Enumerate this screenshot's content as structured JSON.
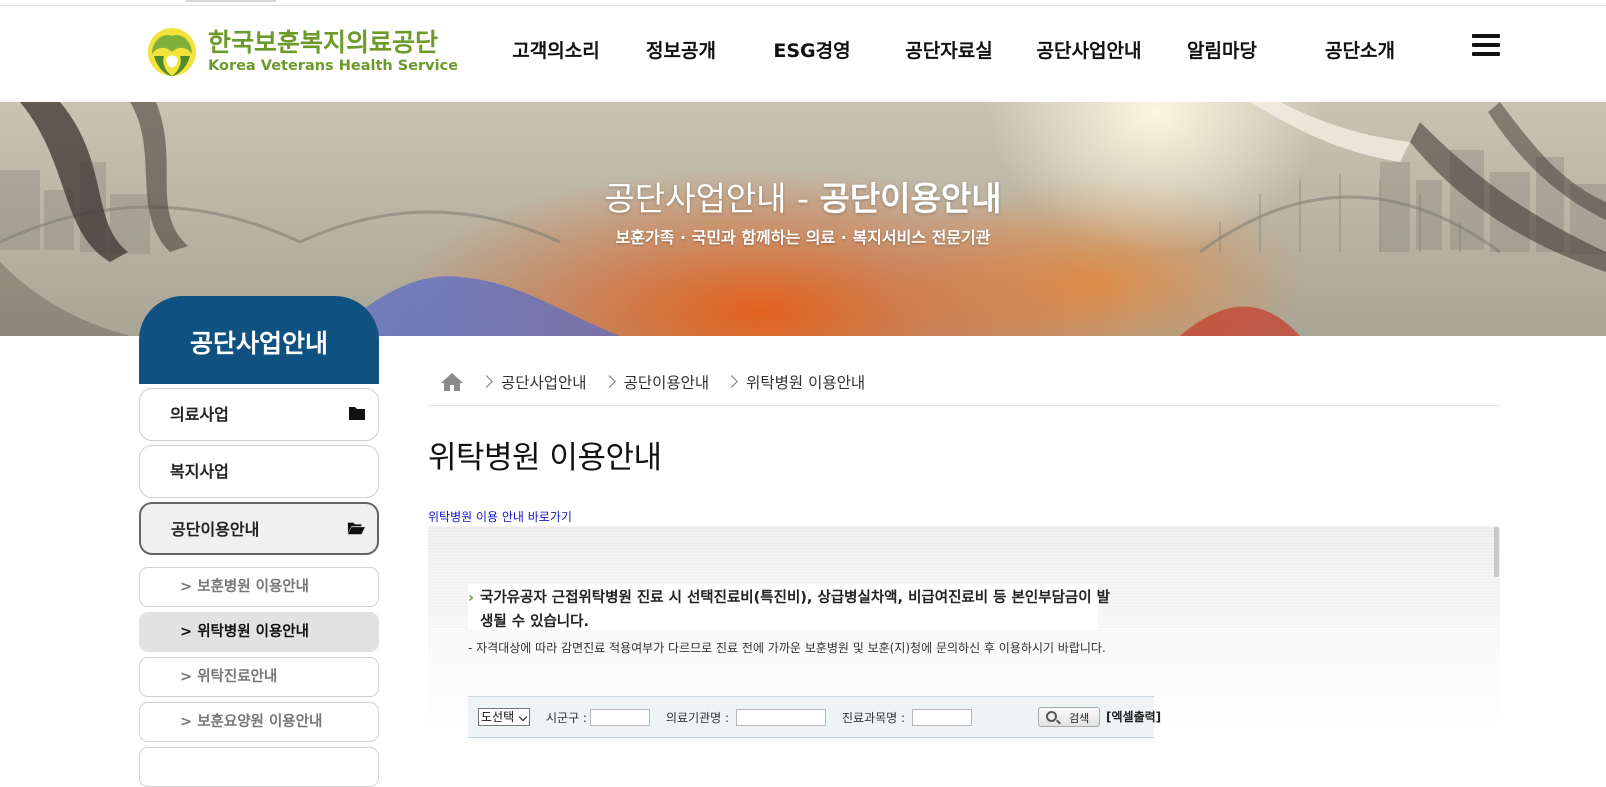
{
  "header": {
    "logo_ko": "한국보훈복지의료공단",
    "logo_en": "Korea Veterans Health Service",
    "nav": [
      {
        "label": "고객의소리"
      },
      {
        "label": "정보공개"
      },
      {
        "label": "ESG경영"
      },
      {
        "label": "공단자료실"
      },
      {
        "label": "공단사업안내"
      },
      {
        "label": "알림마당"
      },
      {
        "label": "공단소개"
      }
    ],
    "menu_icon": "hamburger-icon"
  },
  "banner": {
    "title_part1": "공단사업안내",
    "title_sep": " - ",
    "title_part2": "공단이용안내",
    "subtitle": "보훈가족 · 국민과 함께하는 의료 · 복지서비스 전문기관"
  },
  "sidebar": {
    "heading": "공단사업안내",
    "items": [
      {
        "label": "의료사업",
        "icon": "folder-icon"
      },
      {
        "label": "복지사업"
      },
      {
        "label": "공단이용안내",
        "icon": "folder-open-icon",
        "active": true
      }
    ],
    "sub_items": [
      {
        "label": "> 보훈병원 이용안내"
      },
      {
        "label": "> 위탁병원 이용안내",
        "active": true
      },
      {
        "label": "> 위탁진료안내"
      },
      {
        "label": "> 보훈요양원 이용안내"
      }
    ]
  },
  "breadcrumb": {
    "home_icon": "home-icon",
    "items": [
      "공단사업안내",
      "공단이용안내",
      "위탁병원 이용안내"
    ]
  },
  "main": {
    "title": "위탁병원 이용안내",
    "shortcut_link": "위탁병원 이용 안내 바로가기",
    "notice_main": "국가유공자 근접위탁병원 진료 시 선택진료비(특진비), 상급병실차액, 비급여진료비 등 본인부담금이 발생될 수 있습니다.",
    "notice_sub": "- 자격대상에 따라 감면진료 적용여부가 다르므로 진료 전에 가까운 보훈병원 및 보훈(지)청에 문의하신 후 이용하시기 바랍니다.",
    "search": {
      "select_value": "도선택",
      "label_district": "시군구 :",
      "label_institution": "의료기관명 :",
      "label_department": "진료과목명 :",
      "search_button": "검색",
      "excel_link": "[엑셀출력]"
    }
  },
  "colors": {
    "brand_green": "#6d9a2a",
    "sidebar_blue": "#0f5181",
    "link_blue": "#1414c8"
  }
}
